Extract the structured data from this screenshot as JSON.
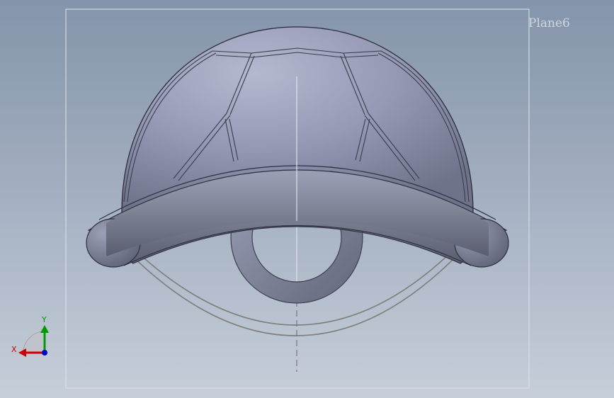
{
  "viewport": {
    "plane_label": "Plane6"
  },
  "triad": {
    "x_label": "X",
    "y_label": "Y",
    "x_color": "#cc0000",
    "y_color": "#009900",
    "z_color": "#0000cc"
  },
  "model": {
    "shell_color": "#8e93ad",
    "rim_color": "#767b93",
    "ring_color": "#7e839b"
  }
}
